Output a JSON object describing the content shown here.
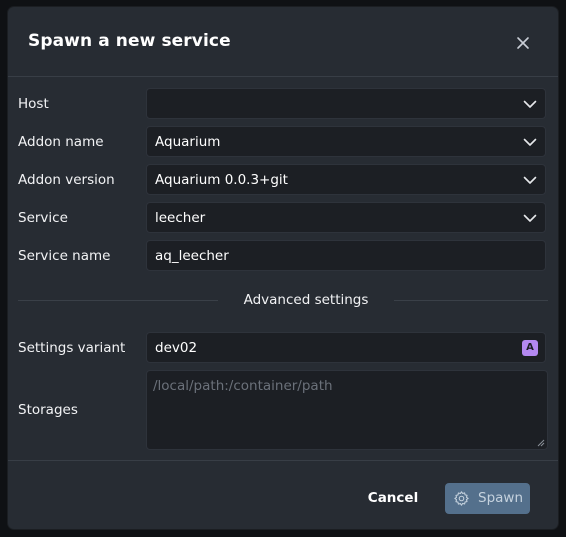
{
  "dialog": {
    "title": "Spawn a new service",
    "close_icon": "close-icon"
  },
  "form": {
    "host": {
      "label": "Host",
      "value": "",
      "icon": "chevron-down-icon"
    },
    "addon_name": {
      "label": "Addon name",
      "value": "Aquarium",
      "icon": "chevron-down-icon"
    },
    "addon_version": {
      "label": "Addon version",
      "value": "Aquarium 0.0.3+git",
      "icon": "chevron-down-icon"
    },
    "service": {
      "label": "Service",
      "value": "leecher",
      "icon": "chevron-down-icon"
    },
    "service_name": {
      "label": "Service name",
      "value": "aq_leecher"
    }
  },
  "advanced": {
    "heading": "Advanced settings",
    "settings_variant": {
      "label": "Settings variant",
      "value": "dev02",
      "badge": "A",
      "badge_color": "#b388f0"
    },
    "storages": {
      "label": "Storages",
      "value": "",
      "placeholder": "/local/path:/container/path"
    }
  },
  "footer": {
    "cancel_label": "Cancel",
    "spawn_label": "Spawn",
    "spawn_icon": "gear-icon",
    "spawn_color": "#54708c"
  }
}
